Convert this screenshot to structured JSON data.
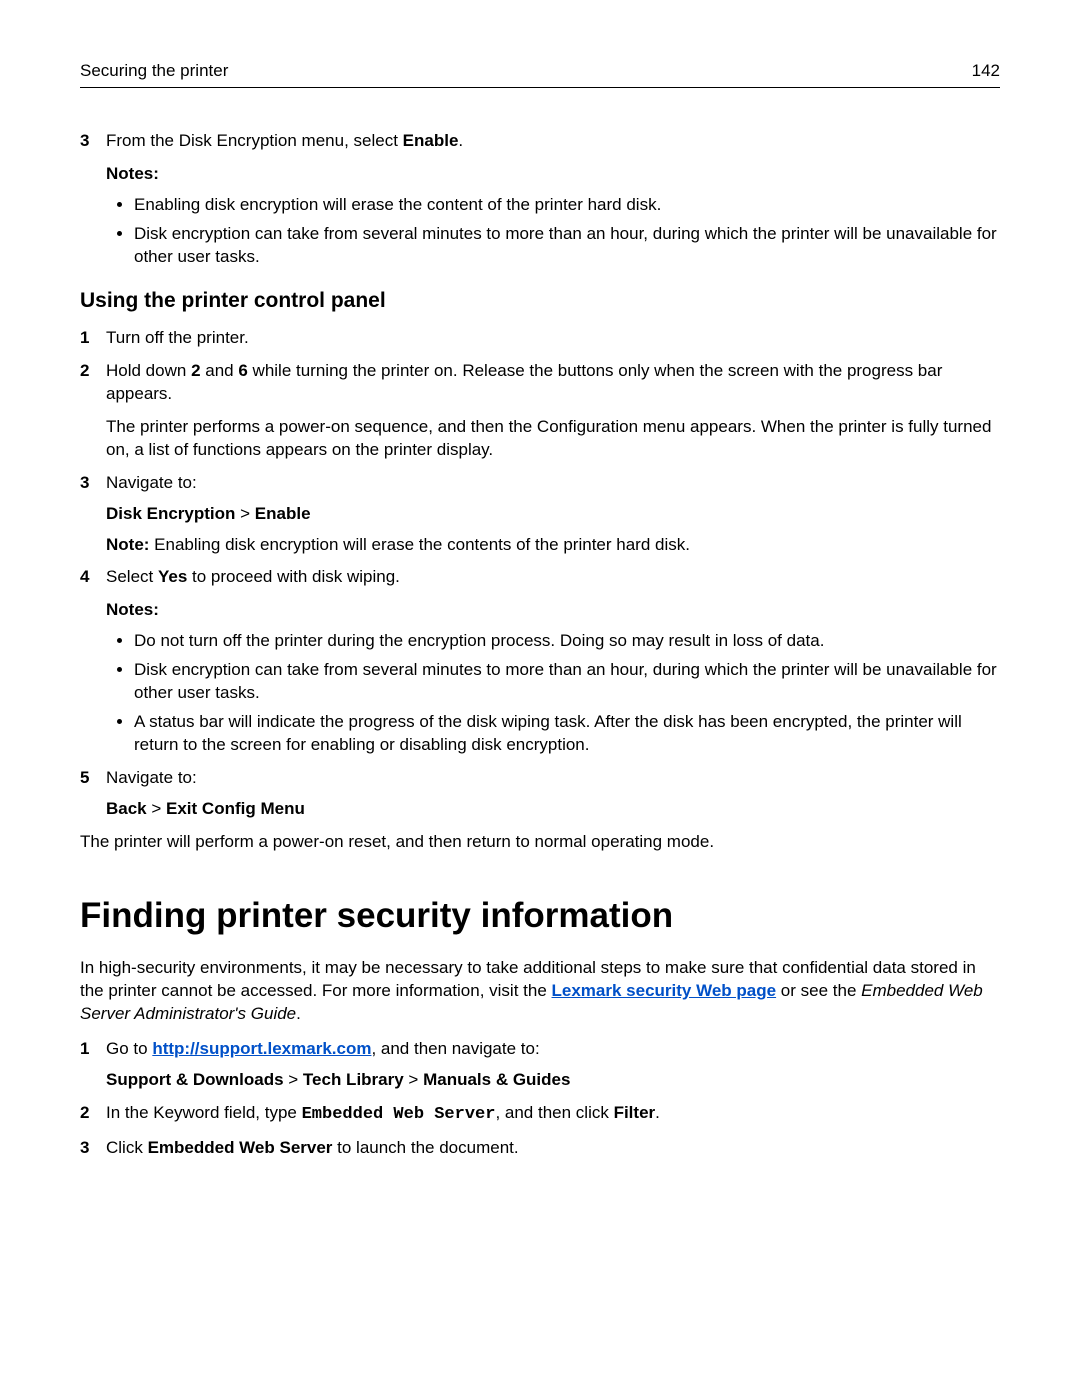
{
  "header": {
    "title": "Securing the printer",
    "page": "142"
  },
  "top": {
    "step3num": "3",
    "step3a": "From the Disk Encryption menu, select ",
    "step3b": "Enable",
    "step3c": ".",
    "notesLabel": "Notes:",
    "b1": "Enabling disk encryption will erase the content of the printer hard disk.",
    "b2": "Disk encryption can take from several minutes to more than an hour, during which the printer will be unavailable for other user tasks."
  },
  "panel": {
    "heading": "Using the printer control panel",
    "s1num": "1",
    "s1": "Turn off the printer.",
    "s2num": "2",
    "s2a": "Hold down ",
    "s2b": "2",
    "s2c": " and ",
    "s2d": "6",
    "s2e": " while turning the printer on. Release the buttons only when the screen with the progress bar appears.",
    "s2para": "The printer performs a power-on sequence, and then the Configuration menu appears. When the printer is fully turned on, a list of functions appears on the printer display.",
    "s3num": "3",
    "s3": "Navigate to:",
    "path1a": "Disk Encryption",
    "path1sep": " > ",
    "path1b": "Enable",
    "note1a": "Note:",
    "note1b": " Enabling disk encryption will erase the contents of the printer hard disk.",
    "s4num": "4",
    "s4a": "Select ",
    "s4b": "Yes",
    "s4c": " to proceed with disk wiping.",
    "notesLabel2": "Notes:",
    "bb1": "Do not turn off the printer during the encryption process. Doing so may result in loss of data.",
    "bb2": "Disk encryption can take from several minutes to more than an hour, during which the printer will be unavailable for other user tasks.",
    "bb3": "A status bar will indicate the progress of the disk wiping task. After the disk has been encrypted, the printer will return to the screen for enabling or disabling disk encryption.",
    "s5num": "5",
    "s5": "Navigate to:",
    "path2a": "Back",
    "path2sep": " > ",
    "path2b": "Exit Config Menu",
    "closing": "The printer will perform a power-on reset, and then return to normal operating mode."
  },
  "finding": {
    "heading": "Finding printer security information",
    "p1a": "In high-security environments, it may be necessary to take additional steps to make sure that confidential data stored in the printer cannot be accessed. For more information, visit the ",
    "p1link": "Lexmark security Web page",
    "p1b": " or see the ",
    "p1italic": "Embedded Web Server Administrator's Guide",
    "p1c": ".",
    "s1num": "1",
    "s1a": "Go to ",
    "s1link": "http://support.lexmark.com",
    "s1b": ", and then navigate to:",
    "pathA": "Support & Downloads",
    "pathSep": " > ",
    "pathB": "Tech Library",
    "pathC": "Manuals & Guides",
    "s2num": "2",
    "s2a": "In the Keyword field, type ",
    "s2mono": "Embedded Web Server",
    "s2b": ", and then click ",
    "s2c": "Filter",
    "s2d": ".",
    "s3num": "3",
    "s3a": "Click ",
    "s3b": "Embedded Web Server",
    "s3c": " to launch the document."
  }
}
